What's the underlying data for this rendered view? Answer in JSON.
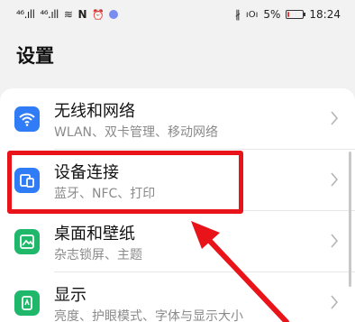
{
  "status_bar": {
    "signal_1": "⁴⁶.ıll",
    "signal_2": "⁴⁶.ıll",
    "wifi": "≋",
    "nfc": "N",
    "alarm": "⏰",
    "bluetooth": "∦",
    "vibrate": "ıOı",
    "battery_percent": "5%",
    "battery_level": 0.05,
    "time": "18:24"
  },
  "header": {
    "title": "设置"
  },
  "items": [
    {
      "title": "无线和网络",
      "subtitle": "WLAN、双卡管理、移动网络",
      "icon": "wifi-icon",
      "icon_bg": "#2f7cf6"
    },
    {
      "title": "设备连接",
      "subtitle": "蓝牙、NFC、打印",
      "icon": "device-connection-icon",
      "icon_bg": "#2f7cf6"
    },
    {
      "title": "桌面和壁纸",
      "subtitle": "杂志锁屏、主题",
      "icon": "wallpaper-icon",
      "icon_bg": "#1fb86a"
    },
    {
      "title": "显示",
      "subtitle": "亮度、护眼模式、字体与显示大小",
      "icon": "display-icon",
      "icon_bg": "#1fb86a"
    }
  ],
  "annotation": {
    "highlight_color": "#e8141a"
  }
}
